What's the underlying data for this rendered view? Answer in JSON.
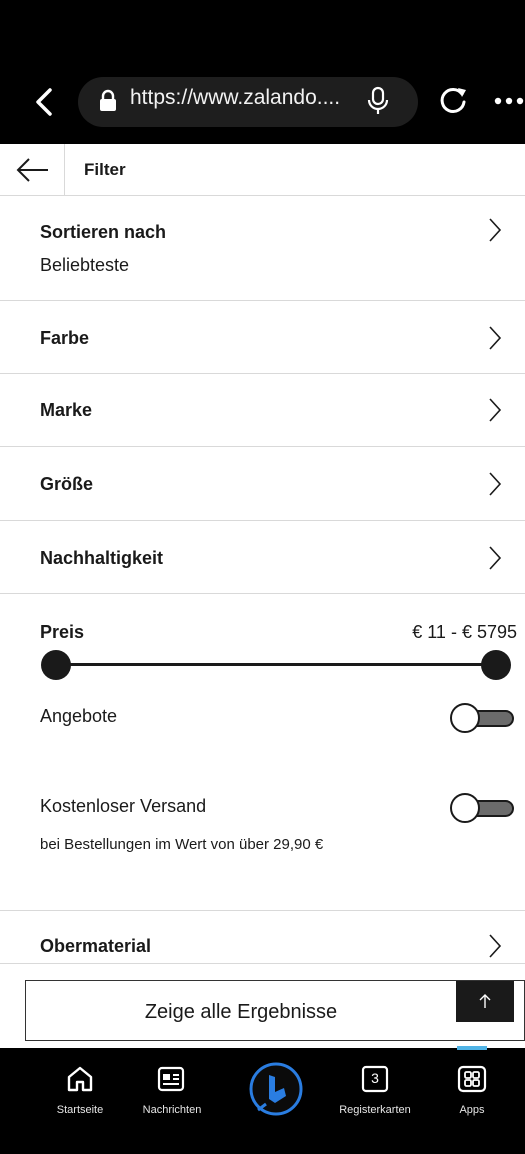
{
  "browser": {
    "url": "https://www.zalando...."
  },
  "header": {
    "title": "Filter"
  },
  "filters": [
    {
      "label": "Sortieren nach",
      "value": "Beliebteste"
    },
    {
      "label": "Farbe"
    },
    {
      "label": "Marke"
    },
    {
      "label": "Größe"
    },
    {
      "label": "Nachhaltigkeit"
    }
  ],
  "price": {
    "label": "Preis",
    "range_text": "€ 11 - € 5795",
    "min": 11,
    "max": 5795,
    "selected_min": 11,
    "selected_max": 5795
  },
  "toggles": {
    "offers": {
      "label": "Angebote",
      "on": false
    },
    "free_shipping": {
      "label": "Kostenloser Versand",
      "on": false,
      "note": "bei Bestellungen im Wert von über 29,90 €"
    }
  },
  "material": {
    "label": "Obermaterial"
  },
  "results_button": {
    "label": "Zeige alle Ergebnisse"
  },
  "bottom_nav": {
    "items": [
      {
        "label": "Startseite",
        "icon": "home-icon"
      },
      {
        "label": "Nachrichten",
        "icon": "news-icon"
      },
      {
        "label": "",
        "icon": "bing-icon"
      },
      {
        "label": "Registerkarten",
        "icon": "tabs-icon",
        "count": "3"
      },
      {
        "label": "Apps",
        "icon": "apps-icon"
      }
    ]
  },
  "colors": {
    "accent": "#4fb3e6",
    "bing": "#2a7de1"
  }
}
